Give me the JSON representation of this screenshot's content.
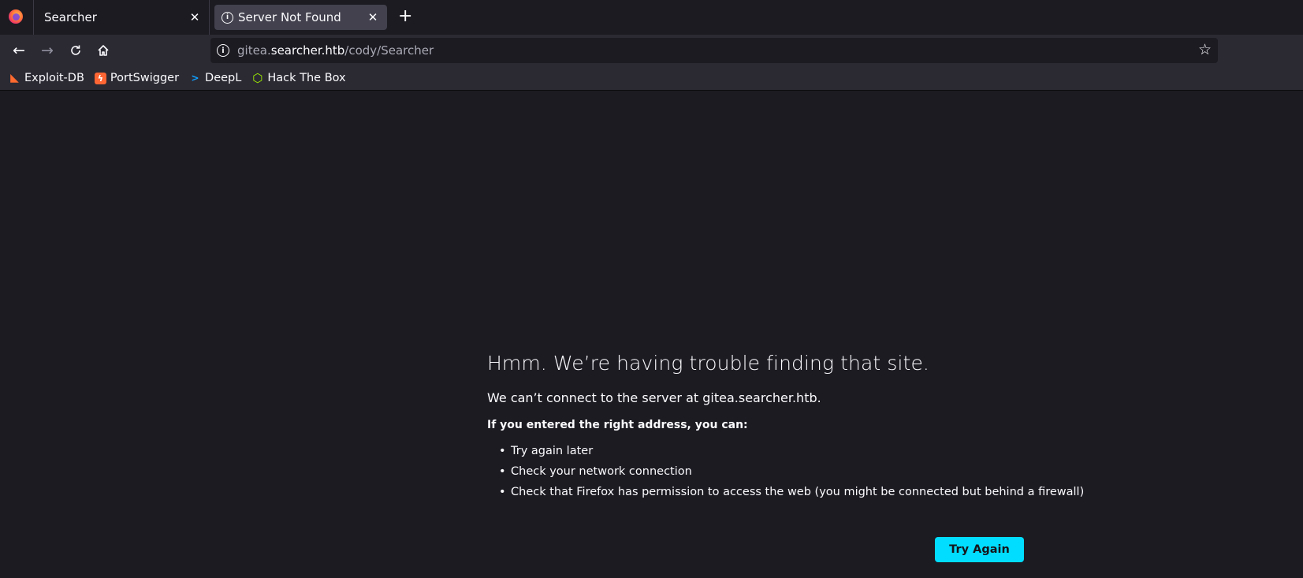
{
  "tabs": [
    {
      "title": "Searcher",
      "active": false
    },
    {
      "title": "Server Not Found",
      "active": true
    }
  ],
  "urlbar": {
    "prefix": "gitea.",
    "domain": "searcher.htb",
    "path": "/cody/Searcher"
  },
  "bookmarks": [
    {
      "label": "Exploit-DB",
      "icon": "exploit-db-icon"
    },
    {
      "label": "PortSwigger",
      "icon": "portswigger-icon"
    },
    {
      "label": "DeepL",
      "icon": "deepl-icon"
    },
    {
      "label": "Hack The Box",
      "icon": "hackthebox-icon"
    }
  ],
  "error": {
    "title": "Hmm. We’re having trouble finding that site.",
    "description": "We can’t connect to the server at gitea.searcher.htb.",
    "subheading": "If you entered the right address, you can:",
    "suggestions": [
      "Try again later",
      "Check your network connection",
      "Check that Firefox has permission to access the web (you might be connected but behind a firewall)"
    ],
    "button_label": "Try Again"
  },
  "colors": {
    "accent": "#00ddff",
    "background": "#1c1b22",
    "toolbar": "#2b2a33"
  }
}
